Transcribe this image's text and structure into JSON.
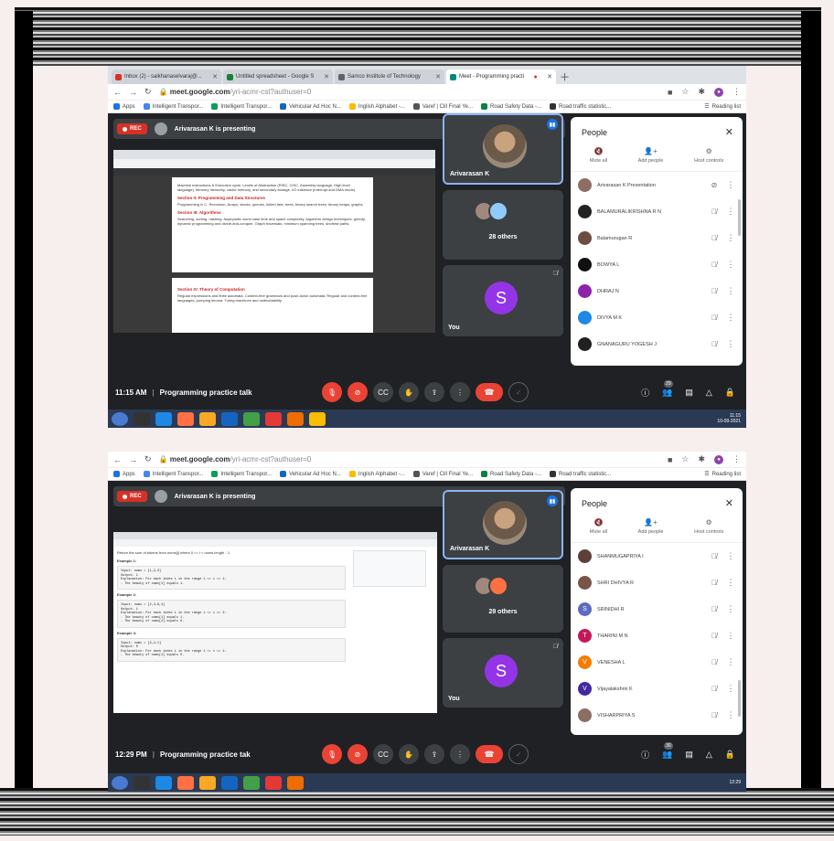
{
  "shot1": {
    "tabs": [
      {
        "label": "Inbox (2) - saikhanaselvaraj@...",
        "color": "#d93025"
      },
      {
        "label": "Untitled spreadsheet - Google S",
        "color": "#188038"
      },
      {
        "label": "Samco Institute of Technology",
        "color": "#5f6368"
      },
      {
        "label": "Meet - Programming practi",
        "color": "#00897b",
        "active": true
      }
    ],
    "url_host": "meet.google.com",
    "url_path": "/yri-acmr-cst?authuser=0",
    "bookmarks": [
      "Apps",
      "Intelligent Transpor...",
      "Intelligent Transpor...",
      "Vehicular Ad Hoc N...",
      "Inglish Alphabet -...",
      "Varef | Cill Final Ye...",
      "Road Safety Data -...",
      "Road traffic statistic..."
    ],
    "reading_list": "Reading list",
    "presenting": "Arivarasan K is presenting",
    "rec": "REC",
    "doc": {
      "sections": [
        {
          "heading": "",
          "text": "Machine instructions & Execution cycle, Levels of Abstraction (RISC, CISC, Assembly language, High level language), Memory hierarchy, cache memory, and secondary storage. I/O interface (Interrupt and DMA mode)."
        },
        {
          "heading": "Section II: Programming and Data Structures",
          "text": "Programming in C, Recursion, Arrays, stacks, queues, linked lists, trees, binary search trees, binary heaps, graphs."
        },
        {
          "heading": "Section III: Algorithms",
          "text": "Searching, sorting, hashing. Asymptotic worst case time and space complexity. Algorithm design techniques: greedy, dynamic programming and divide-and-conquer. Graph traversals, minimum spanning trees, shortest paths."
        },
        {
          "heading": "Section IV: Theory of Computation",
          "text": "Regular expressions and finite automata. Context-free grammars and push-down automata. Regular and context-free languages, pumping lemma. Turing machines and undecidability."
        }
      ]
    },
    "tiles": {
      "presenter_name": "Arivarasan K",
      "others": "28 others",
      "you": "You",
      "you_initial": "S"
    },
    "people": {
      "title": "People",
      "actions": [
        "Mute all",
        "Add people",
        "Host controls"
      ],
      "list": [
        {
          "name": "Arivarasan K\nPresentation",
          "initial": "",
          "color": "#8d6e63"
        },
        {
          "name": "BALAMURALIKRISHNA R N",
          "initial": "",
          "color": "#222222"
        },
        {
          "name": "Balamurugan R",
          "initial": "",
          "color": "#6d4c41"
        },
        {
          "name": "BOWYA L",
          "initial": "",
          "color": "#111111"
        },
        {
          "name": "DHRAJ N",
          "initial": "",
          "color": "#8e24aa"
        },
        {
          "name": "DIVYA M K",
          "initial": "",
          "color": "#1e88e5"
        },
        {
          "name": "GNANAGURU YOGESH J",
          "initial": "",
          "color": "#212121"
        }
      ]
    },
    "time": "11:15 AM",
    "meeting_title": "Programming practice talk",
    "badge": "29",
    "clock": "11:15",
    "date": "10-09-2021"
  },
  "shot2": {
    "url_host": "meet.google.com",
    "url_path": "/yri-acmr-cst?authuser=0",
    "bookmarks": [
      "Apps",
      "Intelligent Transpor...",
      "Intelligent Transpor...",
      "Vehicular Ad Hoc N...",
      "Inglish Alphabet -...",
      "Varef | Cill Final Ye...",
      "Road Safety Data -...",
      "Road traffic statistic..."
    ],
    "reading_list": "Reading list",
    "presenting": "Arivarasan K is presenting",
    "rec": "REC",
    "code": {
      "question": "Return the sum of tokens from nums[i] where 0 <= i < nums.length - 1.",
      "examples": [
        {
          "title": "Example 1:",
          "input": "Input: nums = [1,2,3]",
          "output": "Output: 1",
          "explanation": "Explanation: For each index i in the range 1 <= i <= 1:\n- The beauty of nums[1] equals 1."
        },
        {
          "title": "Example 2:",
          "input": "Input: nums = [2,4,6,4]",
          "output": "Output: 1",
          "explanation": "Explanation: For each index i in the range 1 <= i <= 2:\n- The beauty of nums[1] equals 1.\n- The beauty of nums[2] equals 0."
        },
        {
          "title": "Example 3:",
          "input": "Input: nums = [3,2,1]",
          "output": "Output: 0",
          "explanation": "Explanation: For each index i in the range 1 <= i <= 1:\n- The beauty of nums[1] equals 0."
        }
      ]
    },
    "tiles": {
      "presenter_name": "Arivarasan K",
      "others": "29 others",
      "you": "You",
      "you_initial": "S"
    },
    "people": {
      "title": "People",
      "actions": [
        "Mute all",
        "Add people",
        "Host controls"
      ],
      "list": [
        {
          "name": "SHANMUGAPRIYA I",
          "initial": "",
          "color": "#5d4037"
        },
        {
          "name": "SHRI DHIVYA R",
          "initial": "",
          "color": "#795548"
        },
        {
          "name": "SRINIDHI R",
          "initial": "S",
          "color": "#5c6bc0"
        },
        {
          "name": "THARINI M N",
          "initial": "T",
          "color": "#c2185b"
        },
        {
          "name": "VENESHA L",
          "initial": "V",
          "color": "#f57c00"
        },
        {
          "name": "Vijayalakshmi K",
          "initial": "V",
          "color": "#4527a0"
        },
        {
          "name": "VISHARPRIYA S",
          "initial": "",
          "color": "#8d6e63"
        }
      ]
    },
    "time": "12:29 PM",
    "meeting_title": "Programming practice tak",
    "badge": "30",
    "clock": "12:29"
  },
  "colors": {
    "meet_bg": "#202124",
    "tile_bg": "#3c4043",
    "accent": "#8ab4f8",
    "danger": "#ea4335",
    "taskbar": "#2a3a55"
  }
}
